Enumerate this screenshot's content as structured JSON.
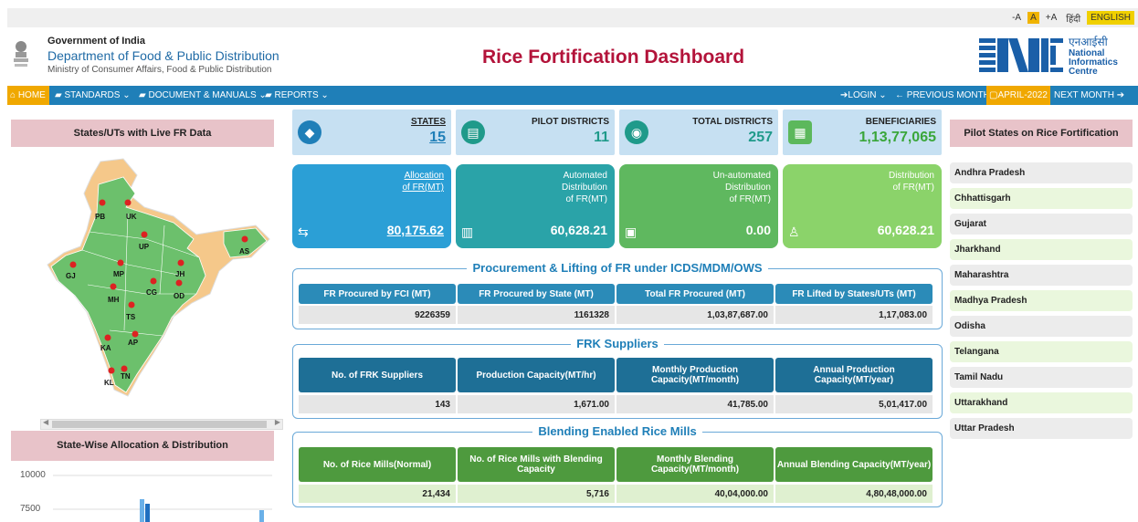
{
  "topbar": {
    "a_minus": "-A",
    "a": "A",
    "a_plus": "+A",
    "hindi": "हिंदी",
    "english": "ENGLISH"
  },
  "header": {
    "gov_line1": "Government of India",
    "gov_line2": "Department of Food & Public Distribution",
    "gov_line3": "Ministry of Consumer Affairs, Food & Public Distribution",
    "title": "Rice Fortification Dashboard",
    "nic_hindi": "एनआईसी",
    "nic_l1": "National",
    "nic_l2": "Informatics",
    "nic_l3": "Centre"
  },
  "nav": {
    "home": "HOME",
    "standards": "STANDARDS",
    "docs": "DOCUMENT & MANUALS",
    "reports": "REPORTS",
    "login": "LOGIN",
    "prev": "PREVIOUS MONTH",
    "month": "APRIL-2022",
    "next": "NEXT MONTH"
  },
  "left": {
    "live_title": "States/UTs with Live FR Data",
    "alloc_title": "State-Wise Allocation & Distribution",
    "y_ticks": [
      "10000",
      "7500"
    ],
    "markers": [
      "PB",
      "UK",
      "UP",
      "AS",
      "GJ",
      "MP",
      "JH",
      "CG",
      "OD",
      "MH",
      "TS",
      "AP",
      "KA",
      "KL",
      "TN"
    ]
  },
  "stats": [
    {
      "label": "STATES",
      "value": "15",
      "color": "#1f7fb8",
      "icon": "india-map-icon"
    },
    {
      "label": "PILOT DISTRICTS",
      "value": "11",
      "color": "#1f9a8a",
      "icon": "store-icon"
    },
    {
      "label": "TOTAL DISTRICTS",
      "value": "257",
      "color": "#1f9a8a",
      "icon": "location-icon"
    },
    {
      "label": "BENEFICIARIES",
      "value": "1,13,77,065",
      "color": "#5cb85c",
      "icon": "document-icon"
    }
  ],
  "tiles": [
    {
      "label": [
        "Allocation",
        "of FR(MT)"
      ],
      "value": "80,175.62"
    },
    {
      "label": [
        "Automated",
        "Distribution",
        "of FR(MT)"
      ],
      "value": "60,628.21"
    },
    {
      "label": [
        "Un-automated",
        "Distribution",
        "of FR(MT)"
      ],
      "value": "0.00"
    },
    {
      "label": [
        "Distribution",
        "of FR(MT)"
      ],
      "value": "60,628.21"
    }
  ],
  "procurement": {
    "title": "Procurement & Lifting of FR under ICDS/MDM/OWS",
    "headers": [
      "FR Procured by FCI (MT)",
      "FR Procured by State (MT)",
      "Total FR Procured (MT)",
      "FR Lifted by States/UTs (MT)"
    ],
    "values": [
      "9226359",
      "1161328",
      "1,03,87,687.00",
      "1,17,083.00"
    ]
  },
  "frk": {
    "title": "FRK Suppliers",
    "headers": [
      "No. of FRK Suppliers",
      "Production Capacity(MT/hr)",
      "Monthly Production Capacity(MT/month)",
      "Annual Production Capacity(MT/year)"
    ],
    "values": [
      "143",
      "1,671.00",
      "41,785.00",
      "5,01,417.00"
    ]
  },
  "blend": {
    "title": "Blending Enabled Rice Mills",
    "headers": [
      "No. of Rice Mills(Normal)",
      "No. of Rice Mills with Blending Capacity",
      "Monthly Blending Capacity(MT/month)",
      "Annual Blending Capacity(MT/year)"
    ],
    "values": [
      "21,434",
      "5,716",
      "40,04,000.00",
      "4,80,48,000.00"
    ]
  },
  "pilot": {
    "title": "Pilot States on Rice Fortification",
    "states": [
      "Andhra Pradesh",
      "Chhattisgarh",
      "Gujarat",
      "Jharkhand",
      "Maharashtra",
      "Madhya Pradesh",
      "Odisha",
      "Telangana",
      "Tamil Nadu",
      "Uttarakhand",
      "Uttar Pradesh"
    ]
  }
}
